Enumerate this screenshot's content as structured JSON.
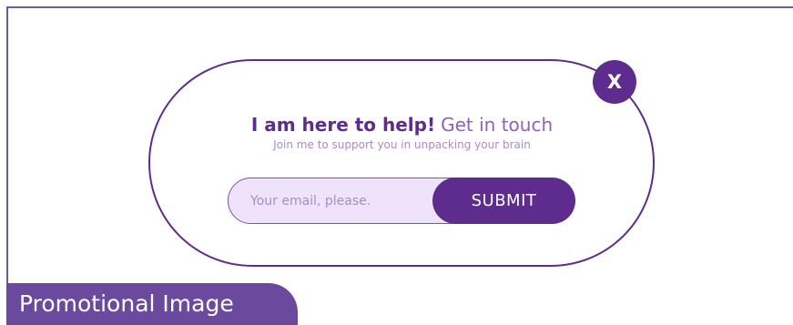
{
  "popup": {
    "close_label": "X",
    "headline_bold": "I am here to help!",
    "headline_light": "Get in touch",
    "subline": "Join me to support you in unpacking your brain",
    "email_placeholder": "Your email, please.",
    "submit_label": "SUBMIT"
  },
  "caption": {
    "label": "Promotional Image"
  },
  "colors": {
    "accent": "#5e2c8c",
    "accent_light": "#8d62b6",
    "input_bg": "#efe3fb",
    "caption_bg": "#6b4a9e"
  }
}
